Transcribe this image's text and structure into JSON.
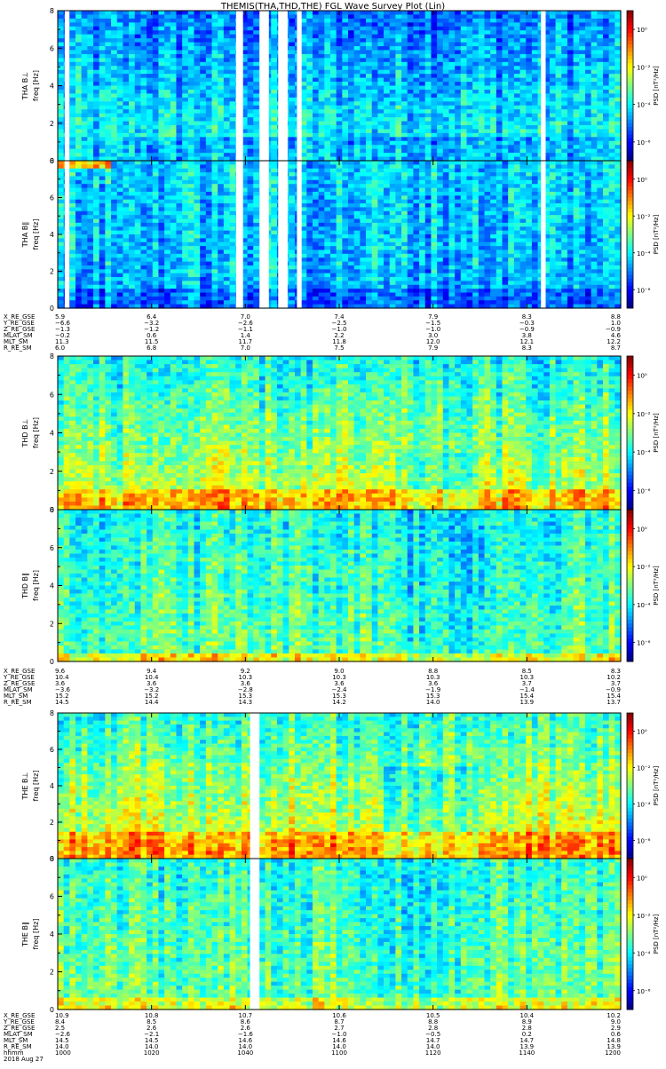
{
  "title": "THEMIS(THA,THD,THE) FGL Wave Survey Plot (Lin)",
  "colorbar": {
    "label": "PSD [nT²/Hz]",
    "tick_labels": [
      "10⁰",
      "10⁻²",
      "10⁻⁴",
      "10⁻⁶"
    ],
    "tick_exponents": [
      0,
      -2,
      -4,
      -6
    ],
    "range_exponent": [
      -7,
      1
    ]
  },
  "panel_ylabel_suffix": "freq [Hz]",
  "chart_data": [
    {
      "type": "heatmap",
      "name": "THA B L",
      "ylabel": "THA B⊥",
      "yticks": [
        "0",
        "2",
        "4",
        "6",
        "8"
      ],
      "ylim": [
        0,
        8
      ],
      "gaps_hhmm": [
        [
          1001.5,
          1002.5
        ],
        [
          1038,
          1039.5
        ],
        [
          1043,
          1045
        ],
        [
          1047,
          1049
        ],
        [
          1051,
          1052
        ],
        [
          1143,
          1144
        ]
      ],
      "background": "low-to-medium PSD, enhanced below 1 Hz"
    },
    {
      "type": "heatmap",
      "name": "THA B par",
      "ylabel": "THA B∥",
      "yticks": [
        "0",
        "2",
        "4",
        "6",
        "8"
      ],
      "ylim": [
        0,
        8
      ],
      "gaps_hhmm": [
        [
          1001.5,
          1002.5
        ],
        [
          1038,
          1039.5
        ],
        [
          1043,
          1045
        ],
        [
          1047,
          1049
        ],
        [
          1051,
          1052
        ],
        [
          1143,
          1144
        ]
      ],
      "background": "low PSD, blue"
    },
    {
      "type": "heatmap",
      "name": "THD B L",
      "ylabel": "THD B⊥",
      "yticks": [
        "0",
        "2",
        "4",
        "6",
        "8"
      ],
      "ylim": [
        0,
        8
      ],
      "gaps_hhmm": [],
      "background": "high PSD, green-yellow-red"
    },
    {
      "type": "heatmap",
      "name": "THD B par",
      "ylabel": "THD B∥",
      "yticks": [
        "0",
        "2",
        "4",
        "6",
        "8"
      ],
      "ylim": [
        0,
        8
      ],
      "gaps_hhmm": [],
      "background": "medium PSD, green"
    },
    {
      "type": "heatmap",
      "name": "THE B L",
      "ylabel": "THE B⊥",
      "yticks": [
        "0",
        "2",
        "4",
        "6",
        "8"
      ],
      "ylim": [
        0,
        8
      ],
      "gaps_hhmm": [
        [
          1041,
          1043
        ]
      ],
      "background": "high PSD, green-yellow-red"
    },
    {
      "type": "heatmap",
      "name": "THE B par",
      "ylabel": "THE B∥",
      "yticks": [
        "0",
        "2",
        "4",
        "6",
        "8"
      ],
      "ylim": [
        0,
        8
      ],
      "gaps_hhmm": [
        [
          1041,
          1043
        ]
      ],
      "background": "medium PSD, green"
    }
  ],
  "ephemeris": [
    {
      "rows": [
        {
          "label": "X_RE_GSE",
          "values": [
            "5.9",
            "6.4",
            "7.0",
            "7.4",
            "7.9",
            "8.3",
            "8.8"
          ]
        },
        {
          "label": "Y_RE_GSE",
          "values": [
            "−6.6",
            "−3.2",
            "−2.6",
            "−2.5",
            "−1.5",
            "−0.3",
            "1.0"
          ]
        },
        {
          "label": "Z_RE_GSE",
          "values": [
            "−1.3",
            "−1.2",
            "−1.1",
            "−1.0",
            "−1.0",
            "−0.9",
            "−0.9"
          ]
        },
        {
          "label": "MLAT_SM",
          "values": [
            "−0.2",
            "0.6",
            "1.4",
            "2.2",
            "3.0",
            "3.8",
            "4.6"
          ]
        },
        {
          "label": "MLT_SM",
          "values": [
            "11.3",
            "11.5",
            "11.7",
            "11.8",
            "12.0",
            "12.1",
            "12.2"
          ]
        },
        {
          "label": "R_RE_SM",
          "values": [
            "6.0",
            "6.8",
            "7.0",
            "7.5",
            "7.9",
            "8.3",
            "8.7"
          ]
        }
      ]
    },
    {
      "rows": [
        {
          "label": "X_RE_GSE",
          "values": [
            "9.6",
            "9.4",
            "9.2",
            "9.0",
            "8.8",
            "8.5",
            "8.3"
          ]
        },
        {
          "label": "Y_RE_GSE",
          "values": [
            "10.4",
            "10.4",
            "10.3",
            "10.3",
            "10.3",
            "10.3",
            "10.2"
          ]
        },
        {
          "label": "Z_RE_GSE",
          "values": [
            "3.6",
            "3.6",
            "3.6",
            "3.6",
            "3.6",
            "3.7",
            "3.7"
          ]
        },
        {
          "label": "MLAT_SM",
          "values": [
            "−3.6",
            "−3.2",
            "−2.8",
            "−2.4",
            "−1.9",
            "−1.4",
            "−0.9"
          ]
        },
        {
          "label": "MLT_SM",
          "values": [
            "15.2",
            "15.2",
            "15.3",
            "15.3",
            "15.3",
            "15.4",
            "15.4"
          ]
        },
        {
          "label": "R_RE_SM",
          "values": [
            "14.5",
            "14.4",
            "14.3",
            "14.2",
            "14.0",
            "13.9",
            "13.7"
          ]
        }
      ]
    },
    {
      "rows": [
        {
          "label": "X_RE_GSE",
          "values": [
            "10.9",
            "10.8",
            "10.7",
            "10.6",
            "10.5",
            "10.4",
            "10.2"
          ]
        },
        {
          "label": "Y_RE_GSE",
          "values": [
            "8.4",
            "8.5",
            "8.6",
            "8.7",
            "8.8",
            "8.9",
            "9.0"
          ]
        },
        {
          "label": "Z_RE_GSE",
          "values": [
            "2.5",
            "2.6",
            "2.6",
            "2.7",
            "2.8",
            "2.8",
            "2.9"
          ]
        },
        {
          "label": "MLAT_SM",
          "values": [
            "−2.6",
            "−2.1",
            "−1.6",
            "−1.0",
            "−0.5",
            "0.2",
            "0.6"
          ]
        },
        {
          "label": "MLT_SM",
          "values": [
            "14.5",
            "14.5",
            "14.6",
            "14.6",
            "14.7",
            "14.7",
            "14.8"
          ]
        },
        {
          "label": "R_RE_SM",
          "values": [
            "14.0",
            "14.0",
            "14.0",
            "14.0",
            "14.0",
            "13.9",
            "13.9"
          ]
        },
        {
          "label": "hhmm",
          "values": [
            "1000",
            "1020",
            "1040",
            "1100",
            "1120",
            "1140",
            "1200"
          ]
        }
      ],
      "date": "2018 Aug 27"
    }
  ]
}
